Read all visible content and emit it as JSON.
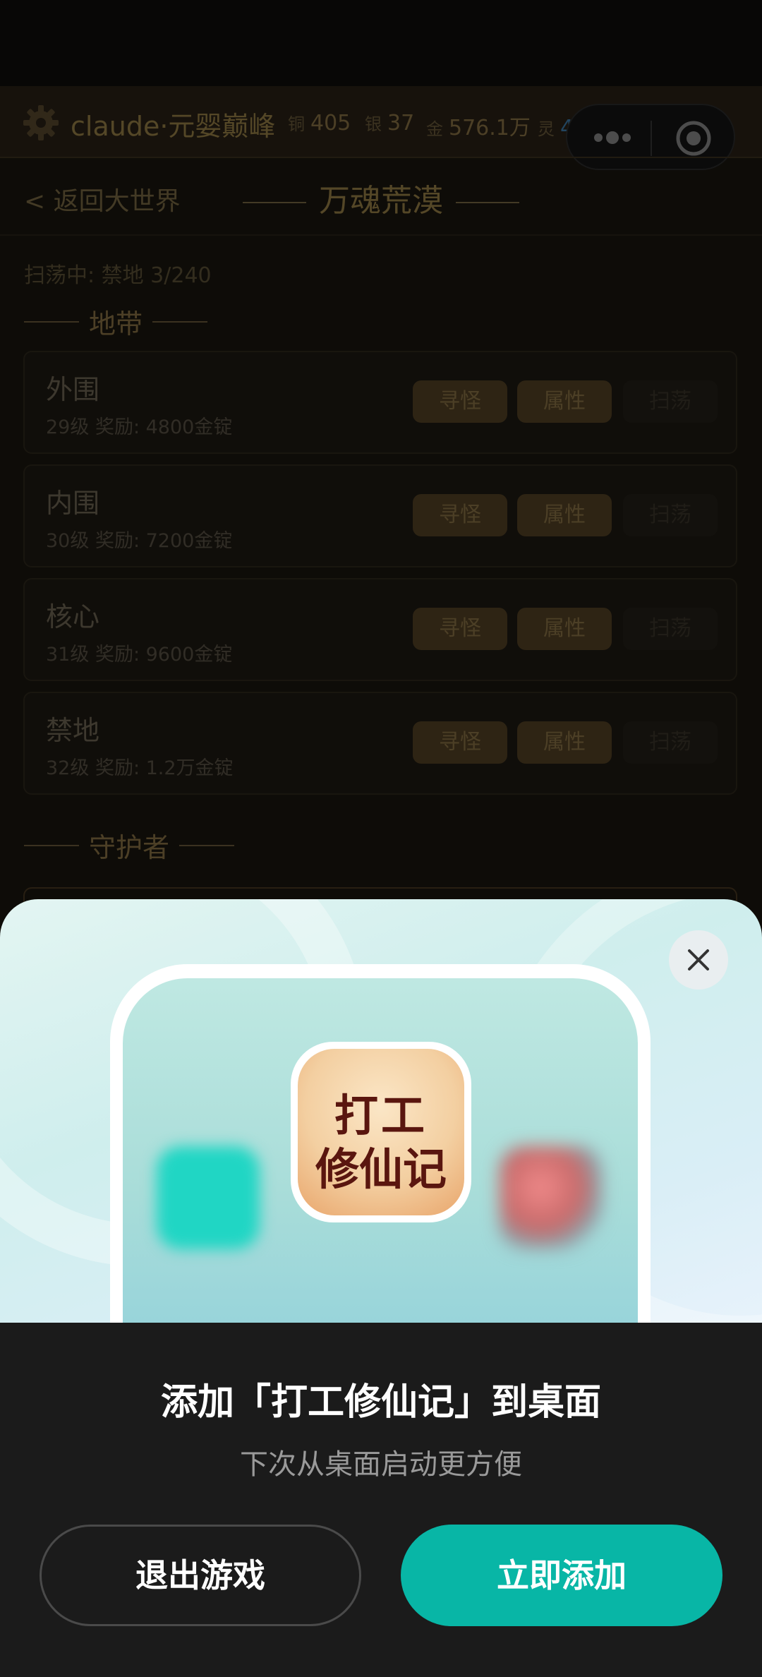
{
  "header": {
    "player_name": "claude·元婴巅峰",
    "currencies": [
      {
        "label": "铜",
        "value": "405"
      },
      {
        "label": "银",
        "value": "37"
      },
      {
        "label": "金",
        "value": "576.1万"
      },
      {
        "label": "灵",
        "value": "4.3万"
      }
    ]
  },
  "nav": {
    "back_label": "< 返回大世界",
    "title": "万魂荒漠"
  },
  "sweep_status": "扫荡中: 禁地 3/240",
  "zones_section": "地带",
  "zones": [
    {
      "name": "外围",
      "info": "29级  奖励: 4800金锭",
      "btn1": "寻怪",
      "btn2": "属性",
      "btn3": "扫荡"
    },
    {
      "name": "内围",
      "info": "30级  奖励: 7200金锭",
      "btn1": "寻怪",
      "btn2": "属性",
      "btn3": "扫荡"
    },
    {
      "name": "核心",
      "info": "31级  奖励: 9600金锭",
      "btn1": "寻怪",
      "btn2": "属性",
      "btn3": "扫荡"
    },
    {
      "name": "禁地",
      "info": "32级  奖励: 1.2万金锭",
      "btn1": "寻怪",
      "btn2": "属性",
      "btn3": "扫荡"
    }
  ],
  "guardian_section": "守护者",
  "dialog": {
    "icon_text_line1": "打工",
    "icon_text_line2": "修仙记",
    "title": "添加「打工修仙记」到桌面",
    "subtitle": "下次从桌面启动更方便",
    "exit_label": "退出游戏",
    "add_label": "立即添加"
  },
  "colors": {
    "accent": "#08b6a6",
    "gold_text": "#9a8148",
    "spirit_text": "#3f7fb0"
  }
}
